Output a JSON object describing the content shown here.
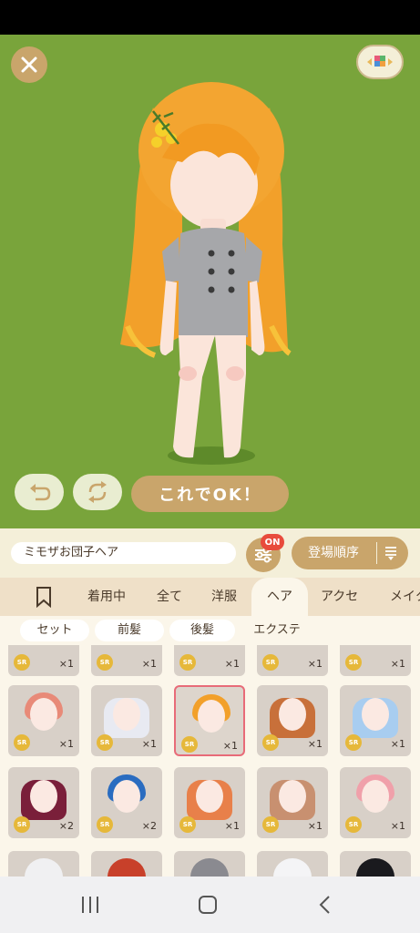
{
  "stage": {
    "ok_button": "これでOK！"
  },
  "toolbar": {
    "item_name": "ミモザお団子ヘア",
    "filter_badge": "ON",
    "sort_label": "登場順序"
  },
  "tabs": [
    {
      "label": "着用中"
    },
    {
      "label": "全て"
    },
    {
      "label": "洋服"
    },
    {
      "label": "ヘア",
      "active": true
    },
    {
      "label": "アクセ"
    },
    {
      "label": "メイク"
    }
  ],
  "subtabs": [
    {
      "label": "セット",
      "active": true
    },
    {
      "label": "前髪",
      "active": true
    },
    {
      "label": "後髪",
      "active": true
    },
    {
      "label": "エクステ"
    }
  ],
  "items": {
    "rarity": "SR",
    "row1_counts": [
      "×1",
      "×1",
      "×1",
      "×1",
      "×1"
    ],
    "row2_counts": [
      "×1",
      "×1",
      "×1",
      "×1",
      "×1"
    ],
    "row3_counts": [
      "×2",
      "×2",
      "×1",
      "×1",
      "×1"
    ]
  },
  "colors": {
    "stage_bg": "#79a43b",
    "accent": "#c9a56b",
    "badge": "#e84b3c",
    "selected_border": "#e86b78"
  },
  "icons": [
    "close-icon",
    "color-palette-icon",
    "undo-icon",
    "shuffle-icon",
    "filter-sliders-icon",
    "sort-icon",
    "bookmark-icon",
    "recent-apps-icon",
    "home-icon",
    "back-icon"
  ]
}
